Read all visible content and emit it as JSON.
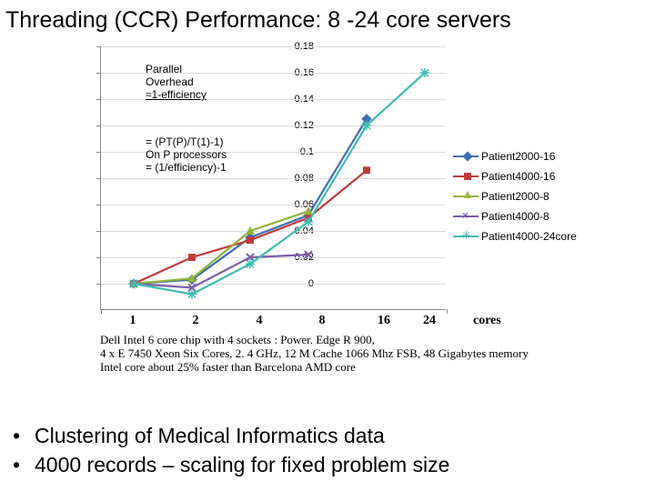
{
  "title": "Threading (CCR) Performance: 8 -24 core servers",
  "annotations": {
    "a1_l1": "Parallel",
    "a1_l2": "Overhead",
    "a1_l3": "≈1-efficiency",
    "a2_l1": "= (PT(P)/T(1)-1)",
    "a2_l2": "On P processors",
    "a2_l3": "= (1/efficiency)-1"
  },
  "x_axis": {
    "l1": "1",
    "l2": "2",
    "l3": "4",
    "l4": "8",
    "l5": "16",
    "l6": "24",
    "suffix": "cores"
  },
  "caption": {
    "l1": "Dell Intel 6 core chip with 4 sockets : Power. Edge R 900,",
    "l2": "4 x E 7450 Xeon Six Cores, 2. 4 GHz, 12 M Cache 1066 Mhz FSB, 48 Gigabytes memory",
    "l3": "Intel core about 25% faster than Barcelona AMD core"
  },
  "bullets": {
    "b1": "Clustering of Medical Informatics data",
    "b2": "4000 records – scaling for fixed problem size"
  },
  "legend": {
    "s1": "Patient2000-16",
    "s2": "Patient4000-16",
    "s3": "Patient2000-8",
    "s4": "Patient4000-8",
    "s5": "Patient4000-24core"
  },
  "chart_data": {
    "type": "line",
    "xlabel": "cores",
    "ylabel": "Parallel Overhead ≈ 1-efficiency",
    "ylim": [
      -0.02,
      0.18
    ],
    "yticks": [
      0,
      0.02,
      0.04,
      0.06,
      0.08,
      0.1,
      0.12,
      0.14,
      0.16,
      0.18
    ],
    "x_categories": [
      1,
      2,
      4,
      8,
      16,
      24
    ],
    "series": [
      {
        "name": "Patient2000-16",
        "color": "#3d6fb5",
        "marker": "diamond",
        "points": [
          [
            1,
            0.0
          ],
          [
            2,
            0.003
          ],
          [
            4,
            0.035
          ],
          [
            8,
            0.052
          ],
          [
            16,
            0.125
          ]
        ]
      },
      {
        "name": "Patient4000-16",
        "color": "#c13a3a",
        "marker": "square",
        "points": [
          [
            1,
            0.0
          ],
          [
            2,
            0.02
          ],
          [
            4,
            0.033
          ],
          [
            8,
            0.05
          ],
          [
            16,
            0.086
          ]
        ]
      },
      {
        "name": "Patient2000-8",
        "color": "#93b23c",
        "marker": "triangle",
        "points": [
          [
            1,
            0.0
          ],
          [
            2,
            0.004
          ],
          [
            4,
            0.04
          ],
          [
            8,
            0.055
          ]
        ]
      },
      {
        "name": "Patient4000-8",
        "color": "#7a5fa6",
        "marker": "x",
        "points": [
          [
            1,
            0.0
          ],
          [
            2,
            -0.003
          ],
          [
            4,
            0.02
          ],
          [
            8,
            0.022
          ]
        ]
      },
      {
        "name": "Patient4000-24core",
        "color": "#3fbdb0",
        "marker": "star",
        "points": [
          [
            1,
            0.0
          ],
          [
            2,
            -0.008
          ],
          [
            4,
            0.015
          ],
          [
            8,
            0.047
          ],
          [
            16,
            0.12
          ],
          [
            24,
            0.16
          ]
        ]
      }
    ]
  }
}
